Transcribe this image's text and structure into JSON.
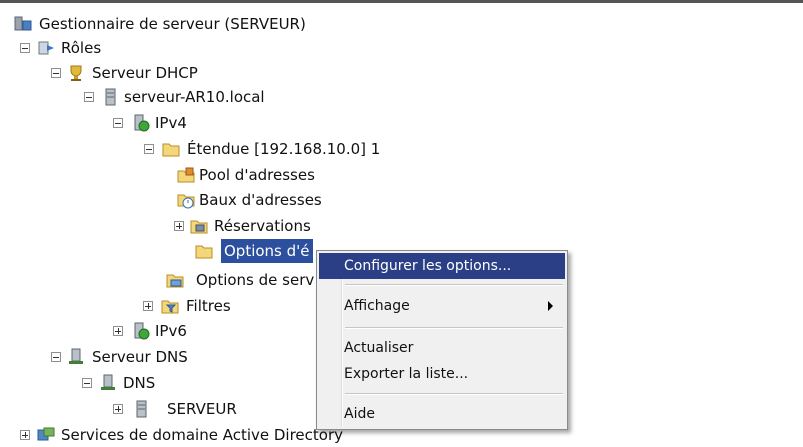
{
  "tree": {
    "root": "Gestionnaire de serveur (SERVEUR)",
    "roles": "Rôles",
    "dhcp_server": "Serveur DHCP",
    "host": "serveur-AR10.local",
    "ipv4": "IPv4",
    "scope": "Étendue [192.168.10.0] 1",
    "address_pool": "Pool d'adresses",
    "address_leases": "Baux d'adresses",
    "reservations": "Réservations",
    "scope_options": "Options d'é",
    "server_options": "Options de serv",
    "filters": "Filtres",
    "ipv6": "IPv6",
    "dns_server": "Serveur DNS",
    "dns": "DNS",
    "serveur": "SERVEUR",
    "ad_services": "Services de domaine Active Directory"
  },
  "menu": {
    "configure": "Configurer les options...",
    "view": "Affichage",
    "refresh": "Actualiser",
    "export": "Exporter la liste...",
    "help": "Aide"
  },
  "colors": {
    "selection": "#2c4f9e",
    "menu_highlight": "#2b3f87",
    "menu_bg": "#f0f0f0"
  }
}
